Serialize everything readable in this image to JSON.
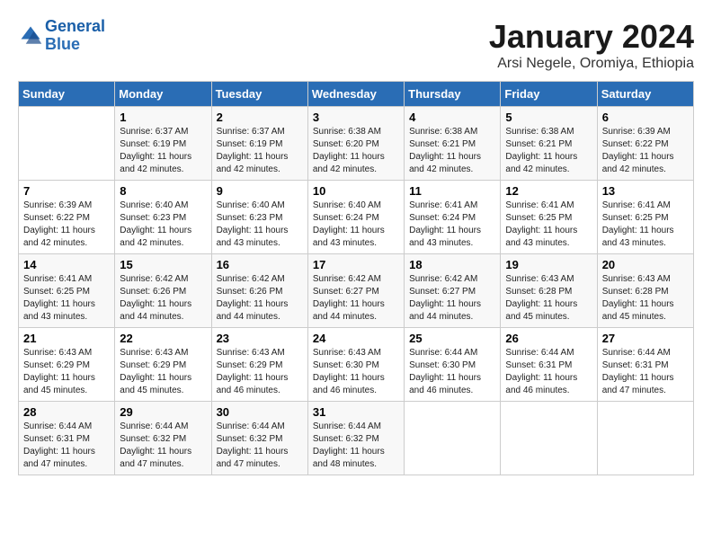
{
  "header": {
    "logo_line1": "General",
    "logo_line2": "Blue",
    "month": "January 2024",
    "location": "Arsi Negele, Oromiya, Ethiopia"
  },
  "days_of_week": [
    "Sunday",
    "Monday",
    "Tuesday",
    "Wednesday",
    "Thursday",
    "Friday",
    "Saturday"
  ],
  "weeks": [
    [
      {
        "day": "",
        "info": ""
      },
      {
        "day": "1",
        "info": "Sunrise: 6:37 AM\nSunset: 6:19 PM\nDaylight: 11 hours and 42 minutes."
      },
      {
        "day": "2",
        "info": "Sunrise: 6:37 AM\nSunset: 6:19 PM\nDaylight: 11 hours and 42 minutes."
      },
      {
        "day": "3",
        "info": "Sunrise: 6:38 AM\nSunset: 6:20 PM\nDaylight: 11 hours and 42 minutes."
      },
      {
        "day": "4",
        "info": "Sunrise: 6:38 AM\nSunset: 6:21 PM\nDaylight: 11 hours and 42 minutes."
      },
      {
        "day": "5",
        "info": "Sunrise: 6:38 AM\nSunset: 6:21 PM\nDaylight: 11 hours and 42 minutes."
      },
      {
        "day": "6",
        "info": "Sunrise: 6:39 AM\nSunset: 6:22 PM\nDaylight: 11 hours and 42 minutes."
      }
    ],
    [
      {
        "day": "7",
        "info": "Sunrise: 6:39 AM\nSunset: 6:22 PM\nDaylight: 11 hours and 42 minutes."
      },
      {
        "day": "8",
        "info": "Sunrise: 6:40 AM\nSunset: 6:23 PM\nDaylight: 11 hours and 42 minutes."
      },
      {
        "day": "9",
        "info": "Sunrise: 6:40 AM\nSunset: 6:23 PM\nDaylight: 11 hours and 43 minutes."
      },
      {
        "day": "10",
        "info": "Sunrise: 6:40 AM\nSunset: 6:24 PM\nDaylight: 11 hours and 43 minutes."
      },
      {
        "day": "11",
        "info": "Sunrise: 6:41 AM\nSunset: 6:24 PM\nDaylight: 11 hours and 43 minutes."
      },
      {
        "day": "12",
        "info": "Sunrise: 6:41 AM\nSunset: 6:25 PM\nDaylight: 11 hours and 43 minutes."
      },
      {
        "day": "13",
        "info": "Sunrise: 6:41 AM\nSunset: 6:25 PM\nDaylight: 11 hours and 43 minutes."
      }
    ],
    [
      {
        "day": "14",
        "info": "Sunrise: 6:41 AM\nSunset: 6:25 PM\nDaylight: 11 hours and 43 minutes."
      },
      {
        "day": "15",
        "info": "Sunrise: 6:42 AM\nSunset: 6:26 PM\nDaylight: 11 hours and 44 minutes."
      },
      {
        "day": "16",
        "info": "Sunrise: 6:42 AM\nSunset: 6:26 PM\nDaylight: 11 hours and 44 minutes."
      },
      {
        "day": "17",
        "info": "Sunrise: 6:42 AM\nSunset: 6:27 PM\nDaylight: 11 hours and 44 minutes."
      },
      {
        "day": "18",
        "info": "Sunrise: 6:42 AM\nSunset: 6:27 PM\nDaylight: 11 hours and 44 minutes."
      },
      {
        "day": "19",
        "info": "Sunrise: 6:43 AM\nSunset: 6:28 PM\nDaylight: 11 hours and 45 minutes."
      },
      {
        "day": "20",
        "info": "Sunrise: 6:43 AM\nSunset: 6:28 PM\nDaylight: 11 hours and 45 minutes."
      }
    ],
    [
      {
        "day": "21",
        "info": "Sunrise: 6:43 AM\nSunset: 6:29 PM\nDaylight: 11 hours and 45 minutes."
      },
      {
        "day": "22",
        "info": "Sunrise: 6:43 AM\nSunset: 6:29 PM\nDaylight: 11 hours and 45 minutes."
      },
      {
        "day": "23",
        "info": "Sunrise: 6:43 AM\nSunset: 6:29 PM\nDaylight: 11 hours and 46 minutes."
      },
      {
        "day": "24",
        "info": "Sunrise: 6:43 AM\nSunset: 6:30 PM\nDaylight: 11 hours and 46 minutes."
      },
      {
        "day": "25",
        "info": "Sunrise: 6:44 AM\nSunset: 6:30 PM\nDaylight: 11 hours and 46 minutes."
      },
      {
        "day": "26",
        "info": "Sunrise: 6:44 AM\nSunset: 6:31 PM\nDaylight: 11 hours and 46 minutes."
      },
      {
        "day": "27",
        "info": "Sunrise: 6:44 AM\nSunset: 6:31 PM\nDaylight: 11 hours and 47 minutes."
      }
    ],
    [
      {
        "day": "28",
        "info": "Sunrise: 6:44 AM\nSunset: 6:31 PM\nDaylight: 11 hours and 47 minutes."
      },
      {
        "day": "29",
        "info": "Sunrise: 6:44 AM\nSunset: 6:32 PM\nDaylight: 11 hours and 47 minutes."
      },
      {
        "day": "30",
        "info": "Sunrise: 6:44 AM\nSunset: 6:32 PM\nDaylight: 11 hours and 47 minutes."
      },
      {
        "day": "31",
        "info": "Sunrise: 6:44 AM\nSunset: 6:32 PM\nDaylight: 11 hours and 48 minutes."
      },
      {
        "day": "",
        "info": ""
      },
      {
        "day": "",
        "info": ""
      },
      {
        "day": "",
        "info": ""
      }
    ]
  ]
}
